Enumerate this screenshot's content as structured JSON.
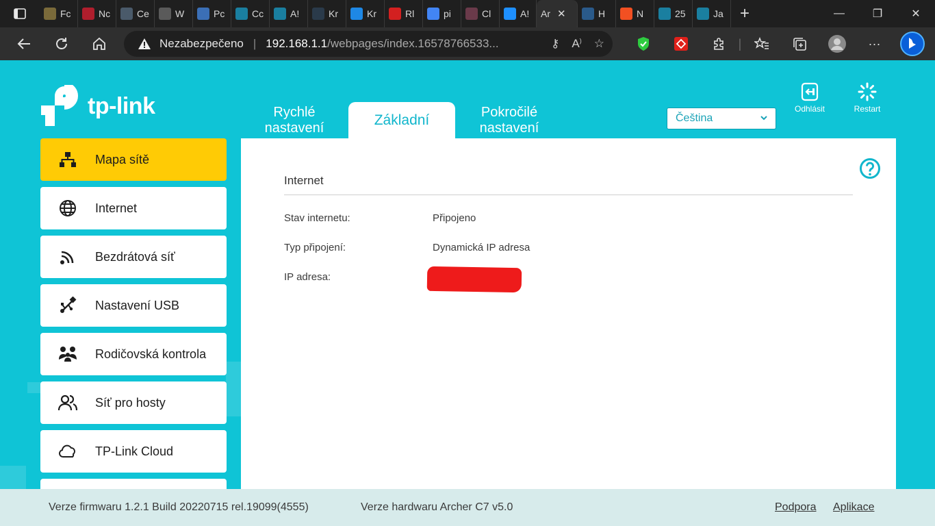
{
  "browser": {
    "tabs": [
      {
        "label": "Fc",
        "color": "#7a6a3a"
      },
      {
        "label": "Nc",
        "color": "#b01e2d"
      },
      {
        "label": "Ce",
        "color": "#4a5a6a"
      },
      {
        "label": "W",
        "color": "#5a5a5a"
      },
      {
        "label": "Pc",
        "color": "#3b6fb6"
      },
      {
        "label": "Cc",
        "color": "#1a7fa0"
      },
      {
        "label": "A!",
        "color": "#1a7fa0"
      },
      {
        "label": "Kr",
        "color": "#2a3a4a"
      },
      {
        "label": "Kr",
        "color": "#1e88e5"
      },
      {
        "label": "Rl",
        "color": "#d32020"
      },
      {
        "label": "pi",
        "color": "#4285f4"
      },
      {
        "label": "Cl",
        "color": "#6a3a4a"
      },
      {
        "label": "A!",
        "color": "#1e90ff"
      }
    ],
    "active_tab": {
      "label": "Ar"
    },
    "tabs_after": [
      {
        "label": "H",
        "color": "#2a5a8a"
      },
      {
        "label": "N",
        "color": "#f25022"
      },
      {
        "label": "25",
        "color": "#1a7fa0"
      },
      {
        "label": "Ja",
        "color": "#1a7fa0"
      }
    ],
    "address": {
      "security": "Nezabezpečeno",
      "host": "192.168.1.1",
      "path": "/webpages/index.16578766533..."
    }
  },
  "router": {
    "brand": "tp-link",
    "tabs": [
      "Rychlé\nnastavení",
      "Základní",
      "Pokročilé\nnastavení"
    ],
    "tab_quick_l1": "Rychlé",
    "tab_quick_l2": "nastavení",
    "tab_basic": "Základní",
    "tab_adv_l1": "Pokročilé",
    "tab_adv_l2": "nastavení",
    "language": "Čeština",
    "logout_label": "Odhlásit",
    "restart_label": "Restart",
    "sidebar": [
      {
        "label": "Mapa sítě"
      },
      {
        "label": "Internet"
      },
      {
        "label": "Bezdrátová síť"
      },
      {
        "label": "Nastavení USB"
      },
      {
        "label": "Rodičovská kontrola"
      },
      {
        "label": "Síť pro hosty"
      },
      {
        "label": "TP-Link Cloud"
      }
    ],
    "panel": {
      "title": "Internet",
      "rows": [
        {
          "key": "Stav internetu:",
          "value": "Připojeno"
        },
        {
          "key": "Typ připojení:",
          "value": "Dynamická IP adresa"
        },
        {
          "key": "IP adresa:",
          "value": ""
        }
      ]
    },
    "footer": {
      "firmware": "Verze firmwaru 1.2.1 Build 20220715 rel.19099(4555)",
      "hardware": "Verze hardwaru Archer C7 v5.0",
      "support": "Podpora",
      "app": "Aplikace"
    },
    "colors": {
      "accent": "#0fc4d6",
      "active": "#ffcb05",
      "text_accent": "#11b6cc"
    }
  }
}
